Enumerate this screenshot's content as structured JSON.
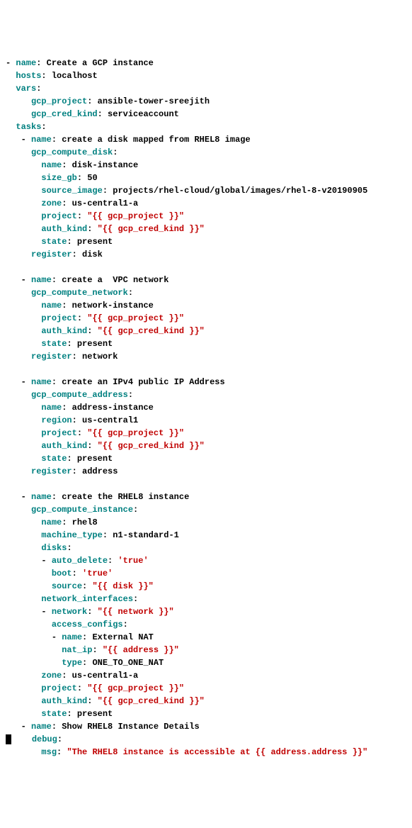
{
  "yaml": {
    "play_name_key": "name",
    "play_name_val": "Create a GCP instance",
    "hosts_key": "hosts",
    "hosts_val": "localhost",
    "vars_key": "vars",
    "gcp_project_key": "gcp_project",
    "gcp_project_val": "ansible-tower-sreejith",
    "gcp_cred_kind_key": "gcp_cred_kind",
    "gcp_cred_kind_val": "serviceaccount",
    "tasks_key": "tasks",
    "t1_name_key": "name",
    "t1_name_val": "create a disk mapped from RHEL8 image",
    "t1_module_key": "gcp_compute_disk",
    "t1_name2_key": "name",
    "t1_name2_val": "disk-instance",
    "t1_size_key": "size_gb",
    "t1_size_val": "50",
    "t1_srcimg_key": "source_image",
    "t1_srcimg_val": "projects/rhel-cloud/global/images/rhel-8-v20190905",
    "t1_zone_key": "zone",
    "t1_zone_val": "us-central1-a",
    "t1_project_key": "project",
    "t1_project_val": "\"{{ gcp_project }}\"",
    "t1_auth_key": "auth_kind",
    "t1_auth_val": "\"{{ gcp_cred_kind }}\"",
    "t1_state_key": "state",
    "t1_state_val": "present",
    "t1_register_key": "register",
    "t1_register_val": "disk",
    "t2_name_key": "name",
    "t2_name_val": "create a  VPC network",
    "t2_module_key": "gcp_compute_network",
    "t2_name2_key": "name",
    "t2_name2_val": "network-instance",
    "t2_project_key": "project",
    "t2_project_val": "\"{{ gcp_project }}\"",
    "t2_auth_key": "auth_kind",
    "t2_auth_val": "\"{{ gcp_cred_kind }}\"",
    "t2_state_key": "state",
    "t2_state_val": "present",
    "t2_register_key": "register",
    "t2_register_val": "network",
    "t3_name_key": "name",
    "t3_name_val": "create an IPv4 public IP Address",
    "t3_module_key": "gcp_compute_address",
    "t3_name2_key": "name",
    "t3_name2_val": "address-instance",
    "t3_region_key": "region",
    "t3_region_val": "us-central1",
    "t3_project_key": "project",
    "t3_project_val": "\"{{ gcp_project }}\"",
    "t3_auth_key": "auth_kind",
    "t3_auth_val": "\"{{ gcp_cred_kind }}\"",
    "t3_state_key": "state",
    "t3_state_val": "present",
    "t3_register_key": "register",
    "t3_register_val": "address",
    "t4_name_key": "name",
    "t4_name_val": "create the RHEL8 instance",
    "t4_module_key": "gcp_compute_instance",
    "t4_name2_key": "name",
    "t4_name2_val": "rhel8",
    "t4_machine_key": "machine_type",
    "t4_machine_val": "n1-standard-1",
    "t4_disks_key": "disks",
    "t4_autodel_key": "auto_delete",
    "t4_autodel_val": "'true'",
    "t4_boot_key": "boot",
    "t4_boot_val": "'true'",
    "t4_source_key": "source",
    "t4_source_val": "\"{{ disk }}\"",
    "t4_netif_key": "network_interfaces",
    "t4_network_key": "network",
    "t4_network_val": "\"{{ network }}\"",
    "t4_access_key": "access_configs",
    "t4_ac_name_key": "name",
    "t4_ac_name_val": "External NAT",
    "t4_natip_key": "nat_ip",
    "t4_natip_val": "\"{{ address }}\"",
    "t4_type_key": "type",
    "t4_type_val": "ONE_TO_ONE_NAT",
    "t4_zone_key": "zone",
    "t4_zone_val": "us-central1-a",
    "t4_project_key": "project",
    "t4_project_val": "\"{{ gcp_project }}\"",
    "t4_auth_key": "auth_kind",
    "t4_auth_val": "\"{{ gcp_cred_kind }}\"",
    "t4_state_key": "state",
    "t4_state_val": "present",
    "t5_name_key": "name",
    "t5_name_val": "Show RHEL8 Instance Details",
    "t5_debug_key": "debug",
    "t5_msg_key": "msg",
    "t5_msg_val": "\"The RHEL8 instance is accessible at {{ address.address }}\""
  }
}
